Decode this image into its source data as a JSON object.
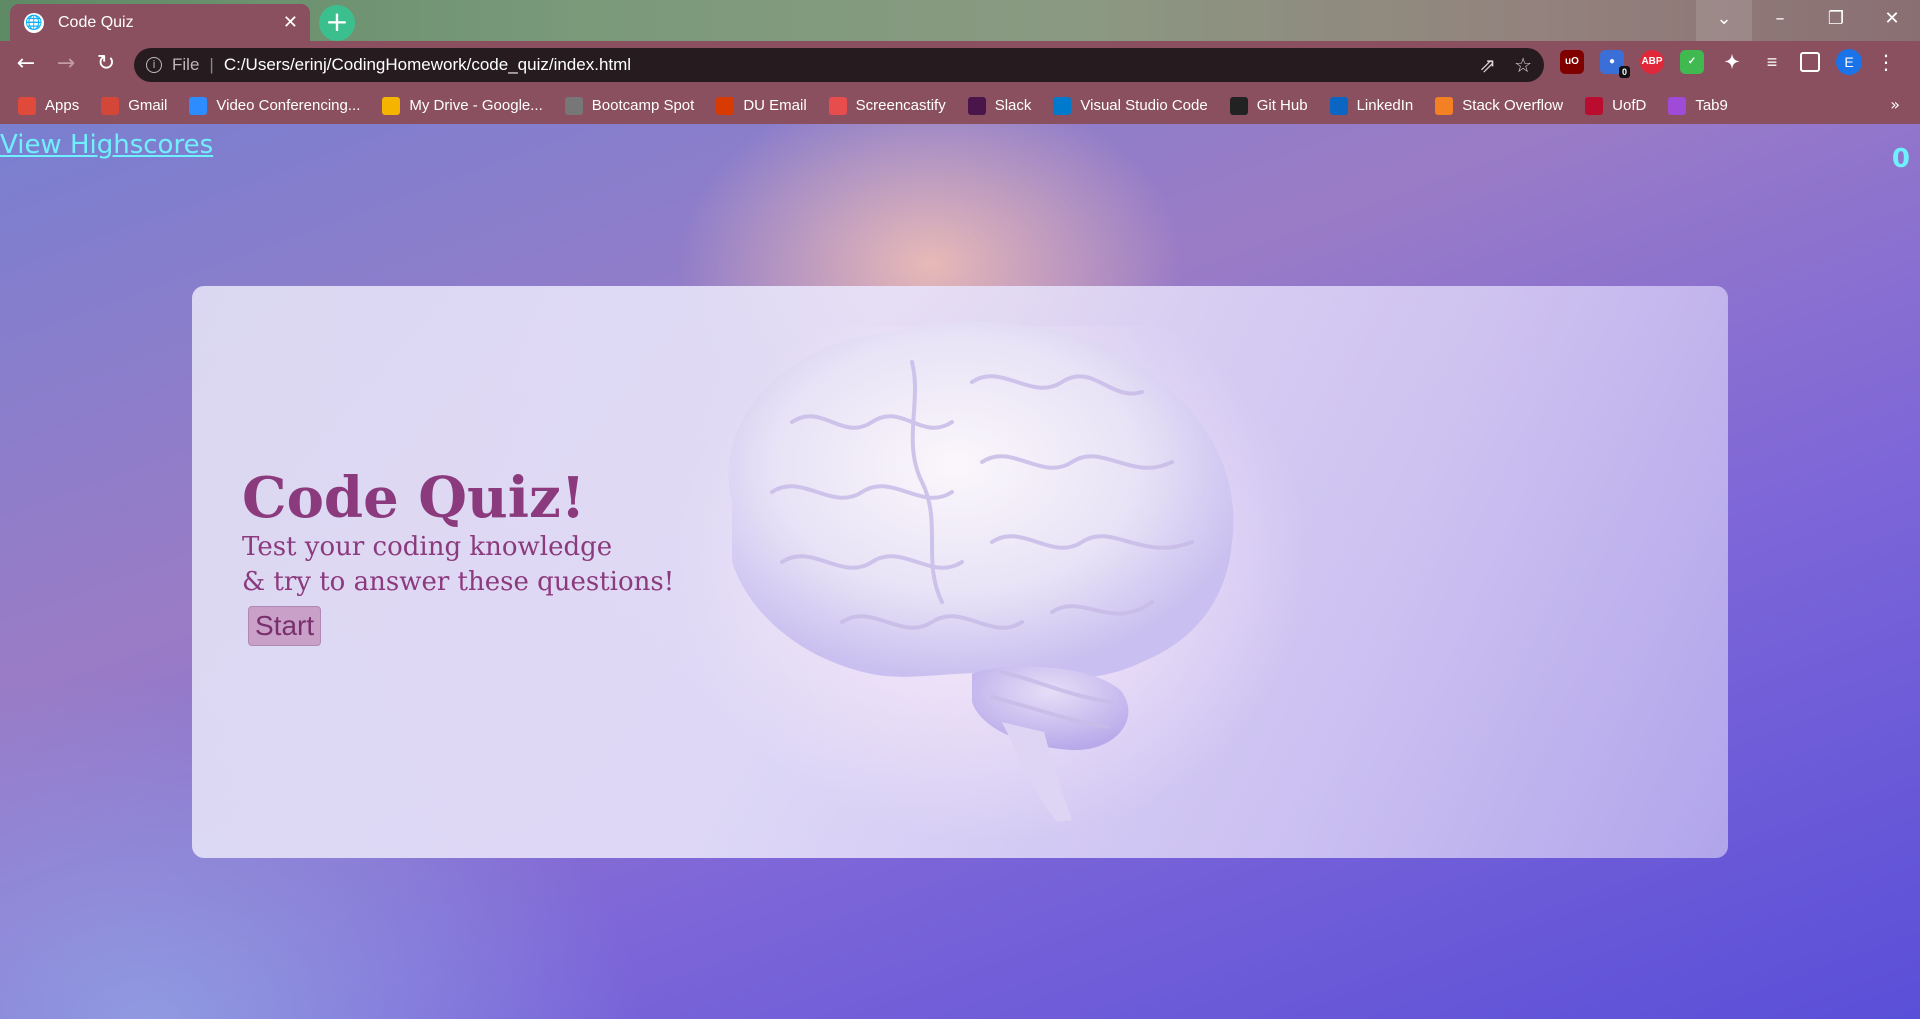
{
  "browser": {
    "tab_title": "Code Quiz",
    "new_tab_label": "+",
    "url_scheme": "File",
    "url": "C:/Users/erinj/CodingHomework/code_quiz/index.html",
    "profile_initial": "E",
    "extension_badge": "0",
    "extensions": [
      "uBlock Origin",
      "Honey",
      "AdBlock Plus",
      "Shield",
      "Extensions",
      "Reading list",
      "Side panel"
    ]
  },
  "bookmarks": [
    {
      "label": "Apps",
      "icon": "apps-grid-icon",
      "color": "#e04a3a"
    },
    {
      "label": "Gmail",
      "icon": "gmail-icon",
      "color": "#d44638"
    },
    {
      "label": "Video Conferencing...",
      "icon": "zoom-icon",
      "color": "#2d8cff"
    },
    {
      "label": "My Drive - Google...",
      "icon": "drive-icon",
      "color": "#f4b400"
    },
    {
      "label": "Bootcamp Spot",
      "icon": "globe-icon",
      "color": "#777777"
    },
    {
      "label": "DU Email",
      "icon": "office-icon",
      "color": "#d83b01"
    },
    {
      "label": "Screencastify",
      "icon": "screencastify-icon",
      "color": "#e84d4d"
    },
    {
      "label": "Slack",
      "icon": "slack-icon",
      "color": "#4a154b"
    },
    {
      "label": "Visual Studio Code",
      "icon": "vscode-icon",
      "color": "#007acc"
    },
    {
      "label": "Git Hub",
      "icon": "github-icon",
      "color": "#222222"
    },
    {
      "label": "LinkedIn",
      "icon": "linkedin-icon",
      "color": "#0a66c2"
    },
    {
      "label": "Stack Overflow",
      "icon": "stackoverflow-icon",
      "color": "#f48024"
    },
    {
      "label": "UofD",
      "icon": "uofd-icon",
      "color": "#ba0c2f"
    },
    {
      "label": "Tab9",
      "icon": "tab9-icon",
      "color": "#a04ad8"
    }
  ],
  "page": {
    "highscores_link": "View Highscores",
    "timer": "0",
    "title": "Code Quiz!",
    "subtitle_line1": "Test your coding knowledge",
    "subtitle_line2": "& try to answer these questions!",
    "start_label": "Start"
  },
  "colors": {
    "accent_cyan": "#6ff0ff",
    "title_purple": "#8b3a7d",
    "chrome": "#8a5060"
  }
}
